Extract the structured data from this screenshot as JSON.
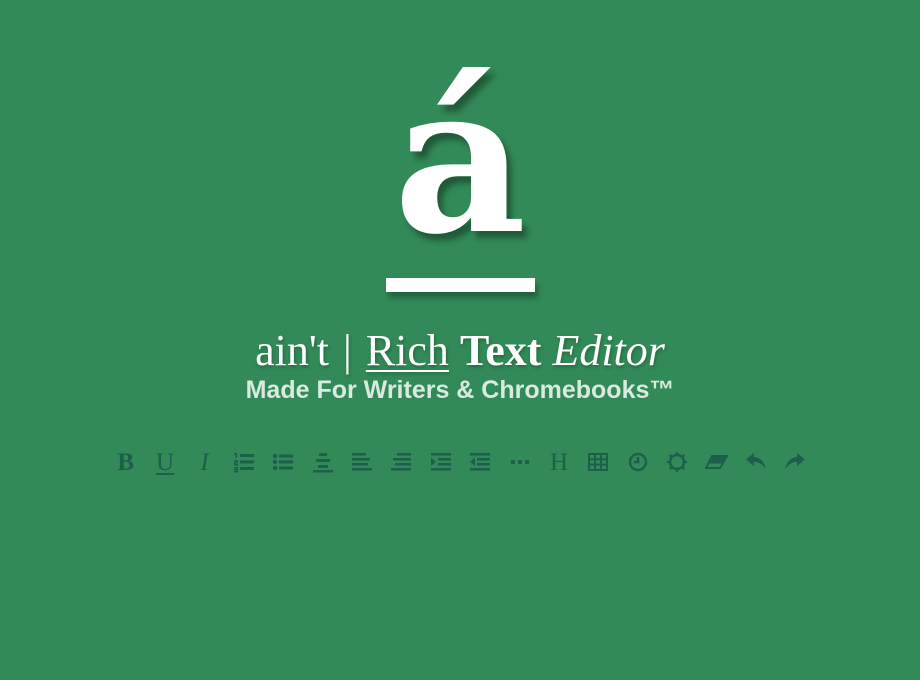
{
  "logo": {
    "glyph": "á"
  },
  "title": {
    "part1": "ain't",
    "separator": "|",
    "rich": "Rich",
    "text": "Text",
    "editor": "Editor"
  },
  "subtitle": "Made For Writers & Chromebooks™",
  "toolbar": {
    "bold": "B",
    "underline": "U",
    "italic": "I",
    "heading": "H",
    "buttons": [
      "bold",
      "underline",
      "italic",
      "ordered-list",
      "unordered-list",
      "align-center",
      "align-left",
      "align-right",
      "indent",
      "outdent",
      "horizontal-rule",
      "heading",
      "table",
      "timestamp",
      "settings",
      "eraser",
      "undo",
      "redo"
    ]
  },
  "colors": {
    "background": "#318a57",
    "icon": "#1c5f4b",
    "logo": "#ffffff",
    "subtitle": "#d9eadf"
  }
}
